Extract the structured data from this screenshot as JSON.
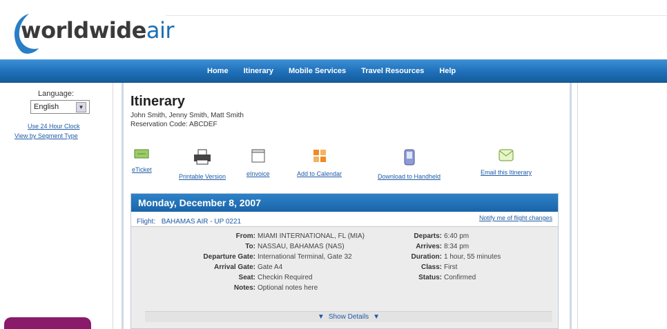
{
  "brand": {
    "logo_text_main": "worldwide",
    "logo_text_accent": "air"
  },
  "nav": {
    "items": [
      "Home",
      "Itinerary",
      "Mobile Services",
      "Travel Resources",
      "Help"
    ]
  },
  "sidebar": {
    "language_label": "Language:",
    "language_value": "English",
    "link_clock": "Use 24 Hour Clock",
    "link_segment": "View by Segment Type"
  },
  "itinerary": {
    "title": "Itinerary",
    "passengers": "John Smith, Jenny Smith, Matt Smith",
    "reservation": "Reservation Code: ABCDEF"
  },
  "tools": [
    {
      "label": "eTicket",
      "icon": "ticket-icon"
    },
    {
      "label": "Printable Version",
      "icon": "printer-icon"
    },
    {
      "label": "eInvoice",
      "icon": "invoice-icon"
    },
    {
      "label": "Add to Calendar",
      "icon": "calendar-icon"
    },
    {
      "label": "Download to Handheld",
      "icon": "handheld-icon"
    },
    {
      "label": "Email this Itinerary",
      "icon": "email-icon"
    }
  ],
  "day": {
    "date": "Monday, December 8, 2007",
    "flight_label": "Flight:",
    "flight_value": "BAHAMAS AIR  -  UP 0221",
    "notify_link": "Notify me of flight changes",
    "left_details": [
      {
        "key": "From:",
        "value": "MIAMI INTERNATIONAL, FL (MIA)"
      },
      {
        "key": "To:",
        "value": "NASSAU, BAHAMAS (NAS)"
      },
      {
        "key": "Departure Gate:",
        "value": "International Terminal, Gate 32"
      },
      {
        "key": "Arrival Gate:",
        "value": "Gate A4"
      },
      {
        "key": "Seat:",
        "value": "Checkin Required"
      },
      {
        "key": "Notes:",
        "value": "Optional notes here"
      }
    ],
    "right_details": [
      {
        "key": "Departs:",
        "value": "6:40 pm"
      },
      {
        "key": "Arrives:",
        "value": "8:34 pm"
      },
      {
        "key": "Duration:",
        "value": "1 hour, 55 minutes"
      },
      {
        "key": "Class:",
        "value": "First"
      },
      {
        "key": "Status:",
        "value": "Confirmed"
      }
    ],
    "show_details": "Show Details"
  },
  "colors": {
    "nav_blue": "#1e6fb8",
    "link_blue": "#1d5aa6",
    "day_header_blue": "#2f82c8",
    "corner_tab": "#8a1a6a"
  }
}
